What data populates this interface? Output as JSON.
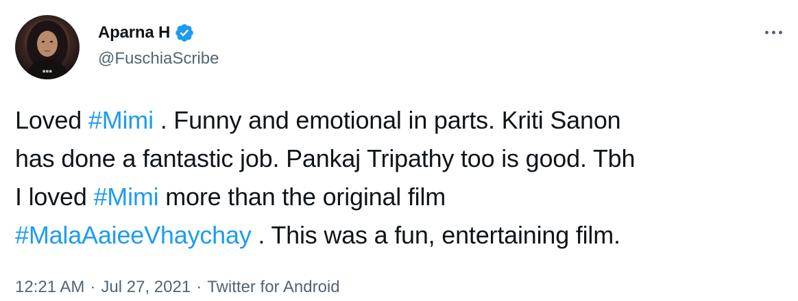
{
  "author": {
    "display_name": "Aparna H",
    "handle": "@FuschiaScribe",
    "verified": true
  },
  "tweet": {
    "lines": [
      [
        {
          "text": "Loved ",
          "type": "text"
        },
        {
          "text": "#Mimi",
          "type": "hashtag"
        },
        {
          "text": " . Funny and emotional in parts. Kriti Sanon",
          "type": "text"
        }
      ],
      [
        {
          "text": "has done a fantastic job. Pankaj Tripathy too is good. Tbh",
          "type": "text"
        }
      ],
      [
        {
          "text": "I loved ",
          "type": "text"
        },
        {
          "text": "#Mimi",
          "type": "hashtag"
        },
        {
          "text": " more than the original film",
          "type": "text"
        }
      ],
      [
        {
          "text": "#MalaAaieeVhaychay",
          "type": "hashtag"
        },
        {
          "text": " . This was a fun, entertaining film.",
          "type": "text"
        }
      ]
    ]
  },
  "meta": {
    "time": "12:21 AM",
    "separator": "·",
    "date": "Jul 27, 2021",
    "source": "Twitter for Android"
  },
  "colors": {
    "hashtag": "#1d9bf0",
    "verified_badge": "#1d9bf0",
    "secondary_text": "#536471",
    "primary_text": "#0f1419"
  },
  "icons": {
    "verified": "verified-badge-icon",
    "more": "more-options-icon"
  }
}
